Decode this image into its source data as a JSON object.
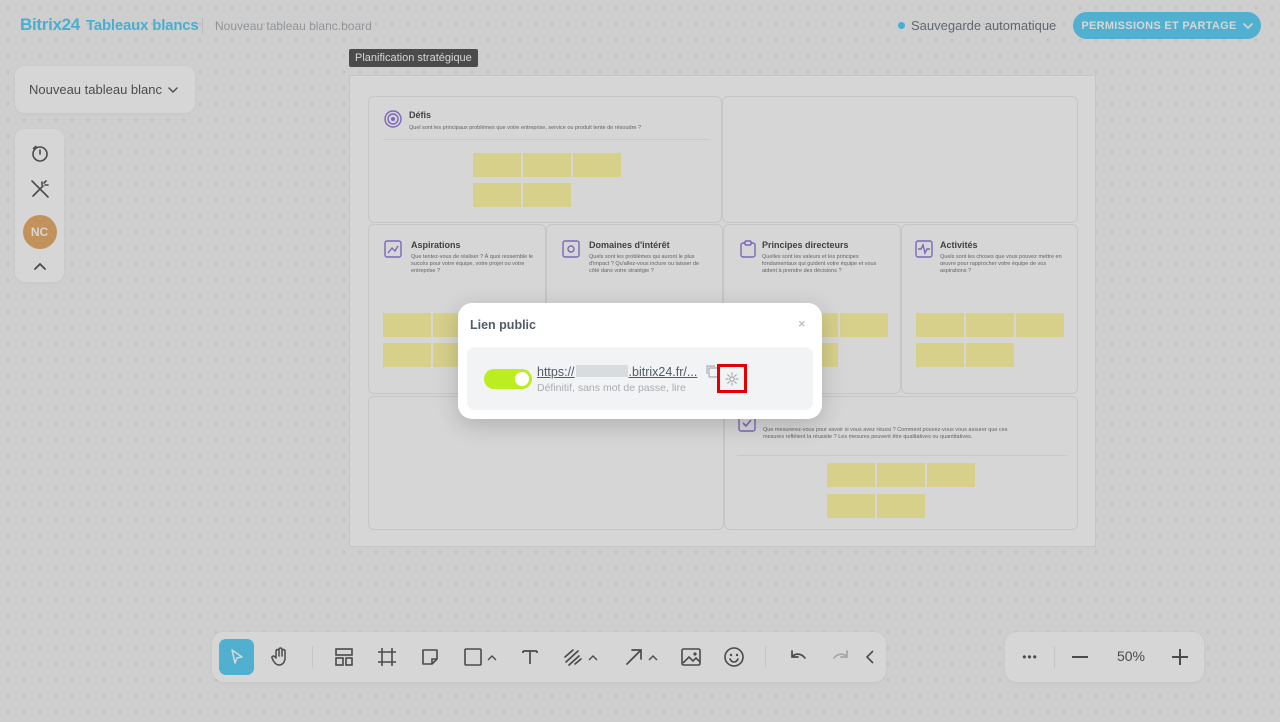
{
  "header": {
    "brand": "Bitrix24",
    "product": "Tableaux blancs",
    "filename": "Nouveau tableau blanc.board",
    "autosave": "Sauvegarde automatique",
    "share_button": "PERMISSIONS ET PARTAGE"
  },
  "left_panel": {
    "board_name": "Nouveau tableau blanc",
    "avatar_initials": "NC"
  },
  "board": {
    "frame_label": "Planification stratégique",
    "cells": [
      {
        "title": "Défis",
        "desc": "Quel sont les principaux problèmes que votre entreprise, service ou produit tente de résoudre ?"
      },
      {
        "title": "Aspirations",
        "desc": "Que tentez-vous de réaliser ? À quoi ressemble le succès pour votre équipe, votre projet ou votre entreprise ?"
      },
      {
        "title": "Domaines d'intérêt",
        "desc": "Quels sont les problèmes qui auront le plus d'impact ? Qu'allez-vous inclure ou laisser de côté dans votre stratégie ?"
      },
      {
        "title": "Principes directeurs",
        "desc": "Quelles sont les valeurs et les principes fondamentaux qui guident votre équipe et vous aident à prendre des décisions ?"
      },
      {
        "title": "Activités",
        "desc": "Quels sont les choses que vous pouvez mettre en œuvre pour rapprocher votre équipe de vos aspirations ?"
      },
      {
        "title": "",
        "desc": "Que mesurerez-vous pour savoir si vous avez réussi ? Comment pouvez-vous vous assurer que ces mesures reflètent la réussite ? Les mesures peuvent être qualitatives ou quantitatives."
      }
    ],
    "sticky_color": "#fff68f"
  },
  "modal": {
    "title": "Lien public",
    "close": "×",
    "url_prefix": "https://",
    "url_suffix": ".bitrix24.fr/...",
    "meta": "Définitif, sans mot de passe, lire",
    "toggle_on": true
  },
  "zoom": {
    "more": "•••",
    "value": "50%"
  },
  "colors": {
    "accent": "#3bc8f5",
    "toggle": "#bbed21",
    "highlight": "#e30000",
    "icon_purple": "#7b5cd6"
  }
}
